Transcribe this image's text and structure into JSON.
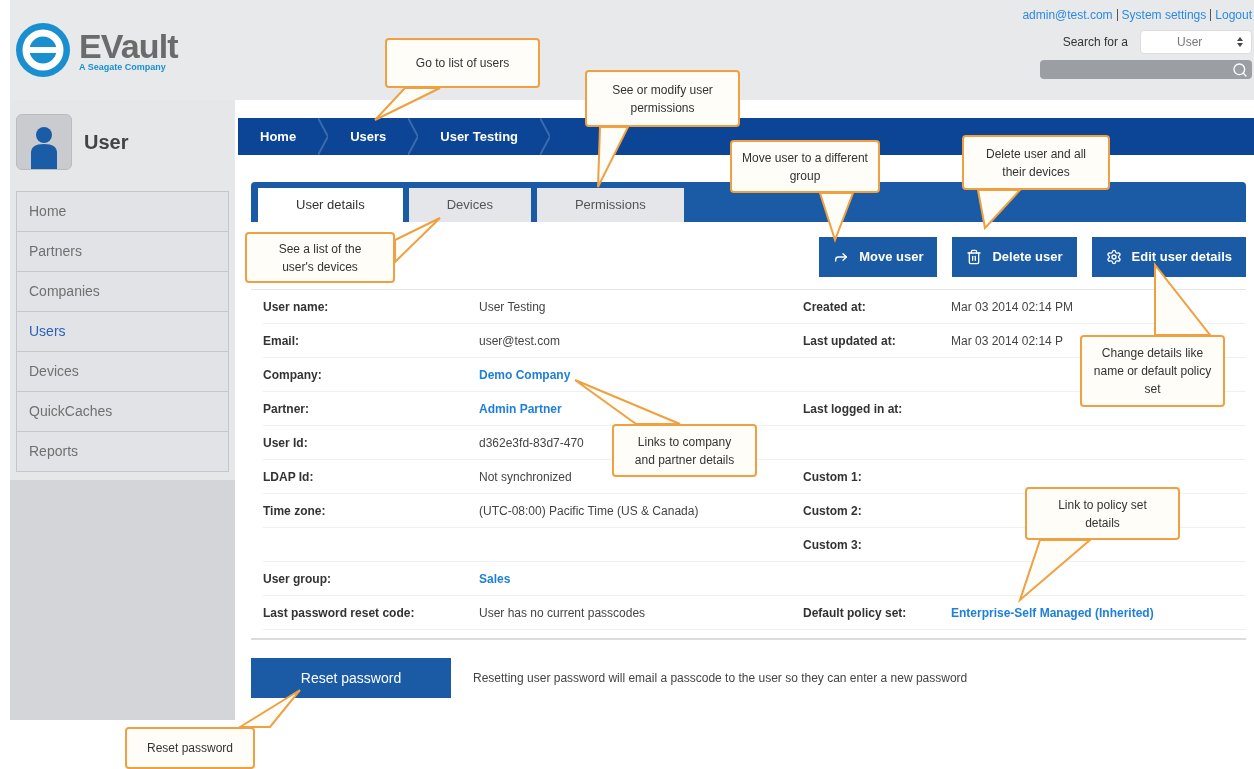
{
  "header": {
    "logo": {
      "name": "EVault",
      "tagline": "A Seagate Company"
    },
    "account_links": [
      "admin@test.com",
      "System settings",
      "Logout"
    ],
    "search": {
      "label": "Search for a",
      "type": "User"
    }
  },
  "sidebar": {
    "title": "User",
    "items": [
      {
        "label": "Home",
        "selected": false
      },
      {
        "label": "Partners",
        "selected": false
      },
      {
        "label": "Companies",
        "selected": false
      },
      {
        "label": "Users",
        "selected": true
      },
      {
        "label": "Devices",
        "selected": false
      },
      {
        "label": "QuickCaches",
        "selected": false
      },
      {
        "label": "Reports",
        "selected": false
      }
    ]
  },
  "breadcrumb": [
    "Home",
    "Users",
    "User Testing"
  ],
  "tabs": [
    {
      "label": "User details",
      "selected": true
    },
    {
      "label": "Devices",
      "selected": false
    },
    {
      "label": "Permissions",
      "selected": false
    }
  ],
  "actions": [
    {
      "label": "Move user",
      "kind": "move"
    },
    {
      "label": "Delete user",
      "kind": "delete"
    },
    {
      "label": "Edit user details",
      "kind": "edit"
    }
  ],
  "details": [
    {
      "left": {
        "label": "User name:",
        "value": "User Testing",
        "link": false
      },
      "right": {
        "label": "Created at:",
        "value": "Mar 03 2014 02:14 PM",
        "link": false
      }
    },
    {
      "left": {
        "label": "Email:",
        "value": "user@test.com",
        "link": false
      },
      "right": {
        "label": "Last updated at:",
        "value": "Mar 03 2014 02:14 P",
        "link": false
      }
    },
    {
      "left": {
        "label": "Company:",
        "value": "Demo Company",
        "link": true
      }
    },
    {
      "left": {
        "label": "Partner:",
        "value": "Admin Partner",
        "link": true
      },
      "right": {
        "label": "Last logged in at:"
      }
    },
    {
      "left": {
        "label": "User Id:",
        "value": "d362e3fd-83d7-470",
        "link": false
      }
    },
    {
      "left": {
        "label": "LDAP Id:",
        "value": "Not synchronized",
        "link": false
      },
      "right": {
        "label": "Custom 1:"
      }
    },
    {
      "left": {
        "label": "Time zone:",
        "value": "(UTC-08:00) Pacific Time (US & Canada)",
        "link": false
      },
      "right": {
        "label": "Custom 2:"
      }
    },
    {
      "right": {
        "label": "Custom 3:"
      }
    },
    {
      "left": {
        "label": "User group:",
        "value": "Sales",
        "link": true
      }
    },
    {
      "left": {
        "label": "Last password reset code:",
        "value": "User has no current passcodes",
        "link": false
      },
      "right": {
        "label": "Default policy set:",
        "value": "Enterprise-Self Managed (Inherited)",
        "link": true
      }
    }
  ],
  "reset": {
    "button": "Reset password",
    "note": "Resetting user password will email a passcode to the user so they can enter a new password"
  },
  "callouts": [
    "Go to list of users",
    "See or modify user permissions",
    "See a list of the user's devices",
    "Move user to a different group",
    "Delete user and all their devices",
    "Change details like name or default policy set",
    "Links to company and partner details",
    "Link to policy set details",
    "Reset password"
  ]
}
